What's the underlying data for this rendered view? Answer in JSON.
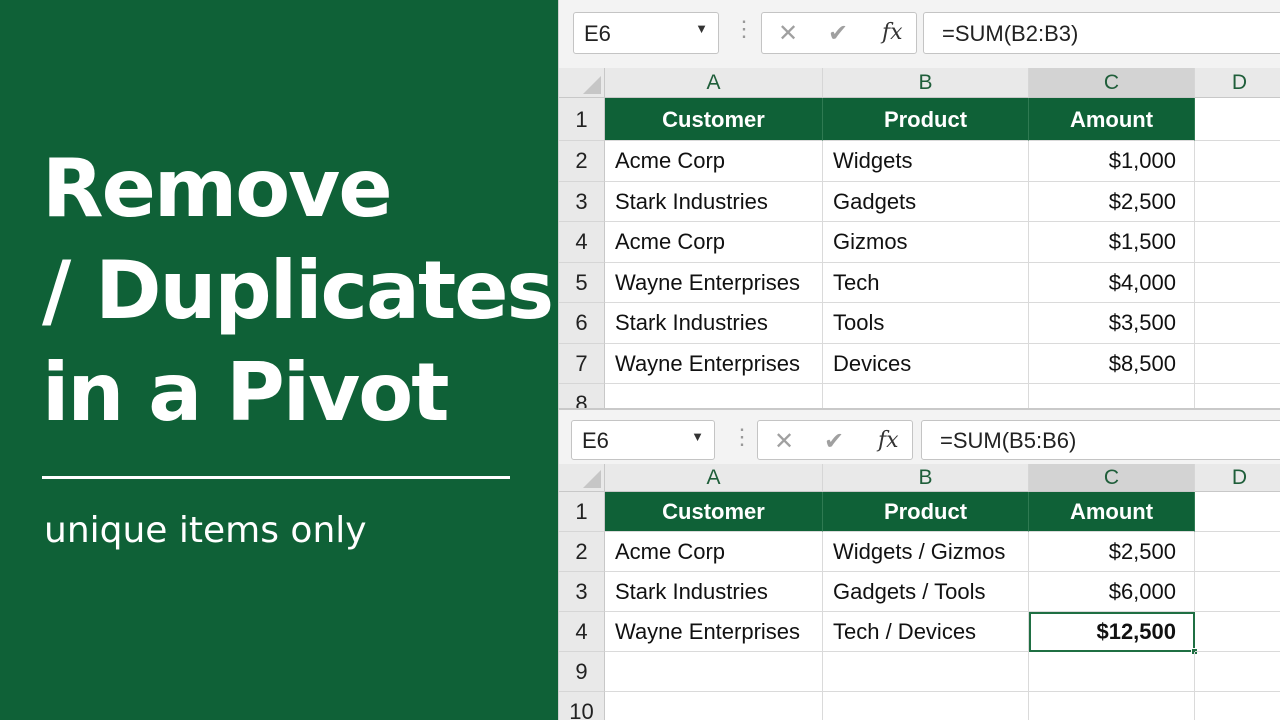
{
  "left_panel": {
    "title_lines": [
      "Remove",
      "/ Duplicates /",
      "in a Pivot"
    ],
    "subtitle": "unique items only",
    "bg_color": "#0f6137"
  },
  "sheet_top": {
    "name_box": "E6",
    "formula": "=SUM(B2:B3)",
    "columns": [
      "A",
      "B",
      "C",
      "D"
    ],
    "rows": [
      {
        "num": "1",
        "cells": [
          "Customer",
          "Product",
          "Amount"
        ]
      },
      {
        "num": "2",
        "cells": [
          "Acme Corp",
          "Widgets",
          "$1,000"
        ]
      },
      {
        "num": "3",
        "cells": [
          "Stark Industries",
          "Gadgets",
          "$2,500"
        ]
      },
      {
        "num": "4",
        "cells": [
          "Acme Corp",
          "Gizmos",
          "$1,500"
        ]
      },
      {
        "num": "5",
        "cells": [
          "Wayne Enterprises",
          "Tech",
          "$4,000"
        ]
      },
      {
        "num": "6",
        "cells": [
          "Stark Industries",
          "Tools",
          "$3,500"
        ]
      },
      {
        "num": "7",
        "cells": [
          "Wayne Enterprises",
          "Devices",
          "$8,500"
        ]
      },
      {
        "num": "8",
        "cells": [
          "",
          "",
          ""
        ]
      }
    ]
  },
  "sheet_bottom": {
    "name_box": "E6",
    "formula": "=SUM(B5:B6)",
    "columns": [
      "A",
      "B",
      "C",
      "D"
    ],
    "rows": [
      {
        "num": "1",
        "cells": [
          "Customer",
          "Product",
          "Amount"
        ]
      },
      {
        "num": "2",
        "cells": [
          "Acme Corp",
          "Widgets / Gizmos",
          "$2,500"
        ]
      },
      {
        "num": "3",
        "cells": [
          "Stark Industries",
          "Gadgets / Tools",
          "$6,000"
        ]
      },
      {
        "num": "4",
        "cells": [
          "Wayne Enterprises",
          "Tech / Devices",
          "$12,500"
        ]
      },
      {
        "num": "9",
        "cells": [
          "",
          "",
          ""
        ]
      },
      {
        "num": "10",
        "cells": [
          "",
          "",
          ""
        ]
      }
    ]
  },
  "icons": [
    "cancel-icon",
    "confirm-icon",
    "fx-icon",
    "dropdown-icon"
  ],
  "accent_color": "#0f6137"
}
